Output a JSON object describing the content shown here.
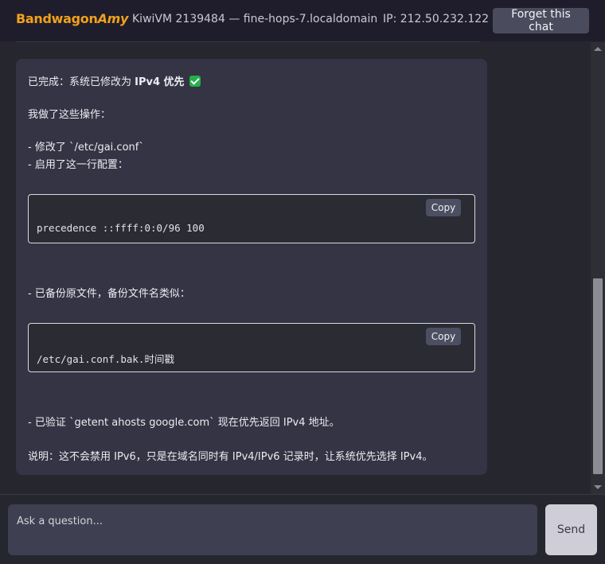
{
  "header": {
    "logo_main": "Bandwagon",
    "logo_accent": "Amy",
    "vm_info": "KiwiVM 2139484 — fine-hops-7.localdomain",
    "ip_info": "IP: 212.50.232.122",
    "forget_label": "Forget this chat"
  },
  "message": {
    "line1_prefix": "已完成：系统已修改为 ",
    "line1_bold": "IPv4 优先",
    "line2": "我做了这些操作：",
    "line3": "- 修改了 `/etc/gai.conf`",
    "line4": "- 启用了这一行配置：",
    "code1": "precedence ::ffff:0:0/96  100",
    "line5": "- 已备份原文件，备份文件名类似：",
    "code2": "/etc/gai.conf.bak.时间戳",
    "line6": "- 已验证 `getent ahosts google.com` 现在优先返回 IPv4 地址。",
    "line7": "说明：这不会禁用 IPv6，只是在域名同时有 IPv4/IPv6 记录时，让系统优先选择 IPv4。",
    "copy_label": "Copy",
    "check_icon": "check-mark-icon"
  },
  "composer": {
    "placeholder": "Ask a question...",
    "value": "",
    "send_label": "Send"
  },
  "colors": {
    "accent": "#f0a21a",
    "check": "#22b04a"
  }
}
